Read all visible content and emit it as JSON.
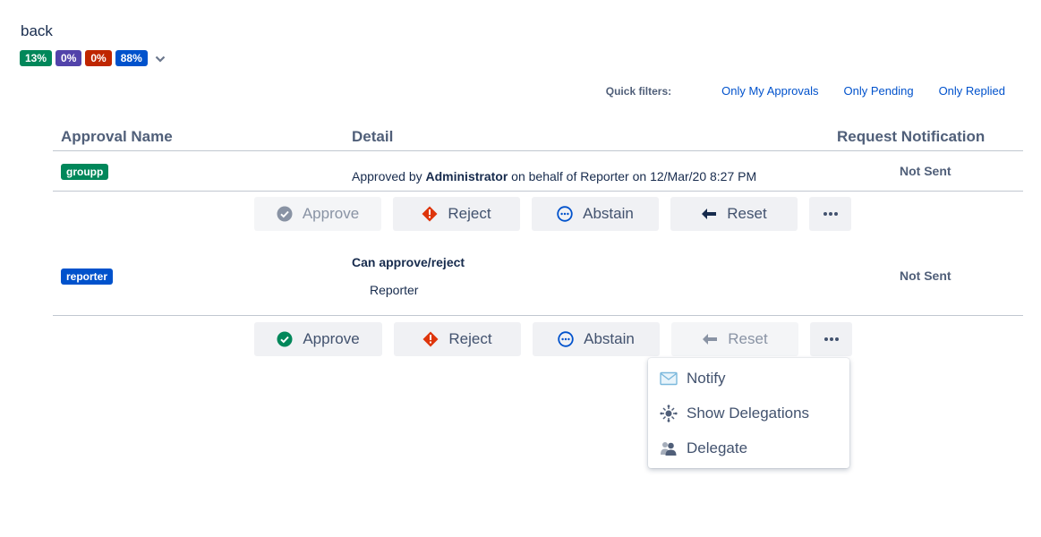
{
  "nav": {
    "back_label": "back"
  },
  "progress_badges": [
    {
      "label": "13%",
      "color": "#00875a"
    },
    {
      "label": "0%",
      "color": "#5243aa"
    },
    {
      "label": "0%",
      "color": "#bf2600"
    },
    {
      "label": "88%",
      "color": "#0052cc"
    }
  ],
  "quick_filters": {
    "label": "Quick filters:",
    "links": [
      "Only My Approvals",
      "Only Pending",
      "Only Replied"
    ]
  },
  "table": {
    "headers": [
      "Approval Name",
      "Detail",
      "Request Notification"
    ],
    "rows": [
      {
        "name": "groupp",
        "name_color": "#00875a",
        "detail_prefix": "Approved by ",
        "detail_bold": "Administrator",
        "detail_suffix": " on behalf of Reporter on 12/Mar/20 8:27 PM",
        "notification": "Not Sent"
      },
      {
        "name": "reporter",
        "name_color": "#0052cc",
        "detail_title": "Can approve/reject",
        "detail_sub": "Reporter",
        "notification": "Not Sent"
      }
    ]
  },
  "actions": {
    "approve": "Approve",
    "reject": "Reject",
    "abstain": "Abstain",
    "reset": "Reset",
    "more": "more-icon"
  },
  "dropdown": {
    "items": [
      {
        "label": "Notify",
        "icon": "mail-icon"
      },
      {
        "label": "Show Delegations",
        "icon": "delegations-icon"
      },
      {
        "label": "Delegate",
        "icon": "delegate-user-icon"
      }
    ]
  },
  "colors": {
    "approve_green": "#00875a",
    "reject_red": "#de350b",
    "abstain_blue": "#0052cc",
    "disabled_grey": "#8993a4"
  }
}
